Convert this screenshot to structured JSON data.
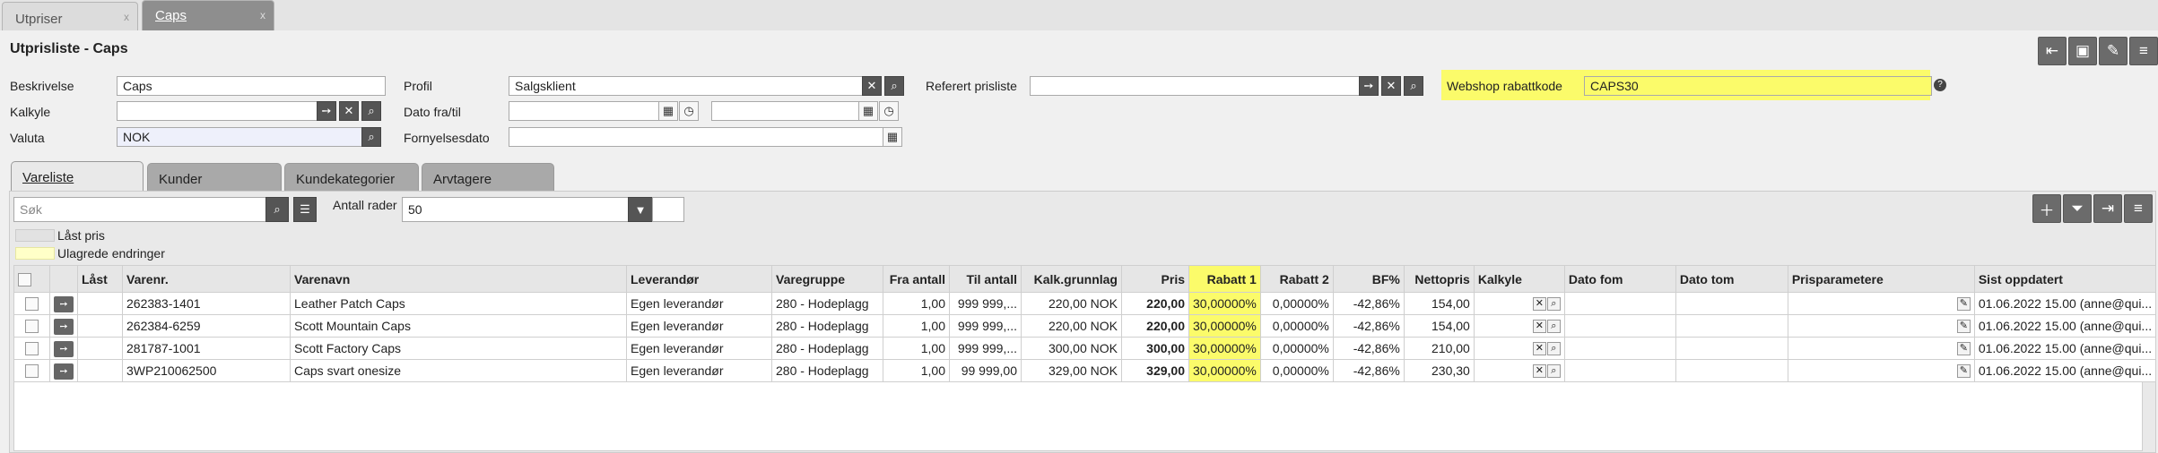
{
  "doc_tabs": [
    {
      "label": "Utpriser",
      "close": "x"
    },
    {
      "label": "Caps",
      "close": "x"
    }
  ],
  "page_title": "Utprisliste - Caps",
  "form": {
    "beskrivelse_label": "Beskrivelse",
    "beskrivelse_value": "Caps",
    "kalkyle_label": "Kalkyle",
    "kalkyle_value": "",
    "valuta_label": "Valuta",
    "valuta_value": "NOK",
    "profil_label": "Profil",
    "profil_value": "Salgsklient",
    "dato_label": "Dato fra/til",
    "dato_fra": "",
    "dato_til": "",
    "fornyelse_label": "Fornyelsesdato",
    "fornyelse_value": "",
    "referert_label": "Referert prisliste",
    "referert_value": "",
    "webshop_label": "Webshop rabattkode",
    "webshop_value": "CAPS30"
  },
  "content_tabs": [
    "Vareliste",
    "Kunder",
    "Kundekategorier",
    "Arvtagere"
  ],
  "search": {
    "placeholder": "Søk"
  },
  "antall_rader_label": "Antall rader",
  "antall_rader_value": "50",
  "legend": {
    "locked": "Låst pris",
    "unsaved": "Ulagrede endringer"
  },
  "colors": {
    "highlight": "#fbfb6a",
    "button_dark": "#6b6b6b"
  },
  "columns": [
    "Låst",
    "Varenr.",
    "Varenavn",
    "Leverandør",
    "Varegruppe",
    "Fra antall",
    "Til antall",
    "Kalk.grunnlag",
    "Pris",
    "Rabatt 1",
    "Rabatt 2",
    "BF%",
    "Nettopris",
    "Kalkyle",
    "Dato fom",
    "Dato tom",
    "Prisparametere",
    "Sist oppdatert"
  ],
  "rows": [
    {
      "varenr": "262383-1401",
      "varenavn": "Leather Patch Caps",
      "leverandor": "Egen leverandør",
      "varegruppe": "280 - Hodeplagg",
      "fra": "1,00",
      "til": "999 999,...",
      "kalk": "220,00 NOK",
      "pris": "220,00",
      "rabatt1": "30,00000%",
      "rabatt2": "0,00000%",
      "bf": "-42,86%",
      "netto": "154,00",
      "sist": "01.06.2022 15.00 (anne@qui..."
    },
    {
      "varenr": "262384-6259",
      "varenavn": "Scott Mountain Caps",
      "leverandor": "Egen leverandør",
      "varegruppe": "280 - Hodeplagg",
      "fra": "1,00",
      "til": "999 999,...",
      "kalk": "220,00 NOK",
      "pris": "220,00",
      "rabatt1": "30,00000%",
      "rabatt2": "0,00000%",
      "bf": "-42,86%",
      "netto": "154,00",
      "sist": "01.06.2022 15.00 (anne@qui..."
    },
    {
      "varenr": "281787-1001",
      "varenavn": "Scott Factory Caps",
      "leverandor": "Egen leverandør",
      "varegruppe": "280 - Hodeplagg",
      "fra": "1,00",
      "til": "999 999,...",
      "kalk": "300,00 NOK",
      "pris": "300,00",
      "rabatt1": "30,00000%",
      "rabatt2": "0,00000%",
      "bf": "-42,86%",
      "netto": "210,00",
      "sist": "01.06.2022 15.00 (anne@qui..."
    },
    {
      "varenr": "3WP210062500",
      "varenavn": "Caps svart onesize",
      "leverandor": "Egen leverandør",
      "varegruppe": "280 - Hodeplagg",
      "fra": "1,00",
      "til": "99 999,00",
      "kalk": "329,00 NOK",
      "pris": "329,00",
      "rabatt1": "30,00000%",
      "rabatt2": "0,00000%",
      "bf": "-42,86%",
      "netto": "230,30",
      "sist": "01.06.2022 15.00 (anne@qui..."
    }
  ]
}
